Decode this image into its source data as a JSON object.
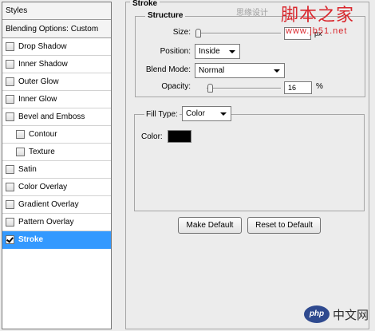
{
  "styles_panel": {
    "header": "Styles",
    "blending_options": "Blending Options: Custom",
    "items": [
      {
        "label": "Drop Shadow",
        "checked": false,
        "sub": false,
        "selected": false
      },
      {
        "label": "Inner Shadow",
        "checked": false,
        "sub": false,
        "selected": false
      },
      {
        "label": "Outer Glow",
        "checked": false,
        "sub": false,
        "selected": false
      },
      {
        "label": "Inner Glow",
        "checked": false,
        "sub": false,
        "selected": false
      },
      {
        "label": "Bevel and Emboss",
        "checked": false,
        "sub": false,
        "selected": false
      },
      {
        "label": "Contour",
        "checked": false,
        "sub": true,
        "selected": false
      },
      {
        "label": "Texture",
        "checked": false,
        "sub": true,
        "selected": false
      },
      {
        "label": "Satin",
        "checked": false,
        "sub": false,
        "selected": false
      },
      {
        "label": "Color Overlay",
        "checked": false,
        "sub": false,
        "selected": false
      },
      {
        "label": "Gradient Overlay",
        "checked": false,
        "sub": false,
        "selected": false
      },
      {
        "label": "Pattern Overlay",
        "checked": false,
        "sub": false,
        "selected": false
      },
      {
        "label": "Stroke",
        "checked": true,
        "sub": false,
        "selected": true
      }
    ]
  },
  "stroke": {
    "title": "Stroke",
    "structure": {
      "title": "Structure",
      "size_label": "Size:",
      "size_unit": "px",
      "position_label": "Position:",
      "position_value": "Inside",
      "blend_mode_label": "Blend Mode:",
      "blend_mode_value": "Normal",
      "opacity_label": "Opacity:",
      "opacity_value": "16",
      "opacity_unit": "%"
    },
    "fill": {
      "fill_type_label": "Fill Type:",
      "fill_type_value": "Color",
      "color_label": "Color:",
      "color_value": "#000000"
    },
    "make_default": "Make Default",
    "reset_default": "Reset to Default"
  },
  "watermark": {
    "top_text": "思缘设计",
    "brand": "脚本之家",
    "url": "www.jb51.net",
    "php_logo": "php",
    "php_text": "中文网"
  },
  "colors": {
    "selection": "#3399ff",
    "watermark_red": "#d9262c"
  }
}
